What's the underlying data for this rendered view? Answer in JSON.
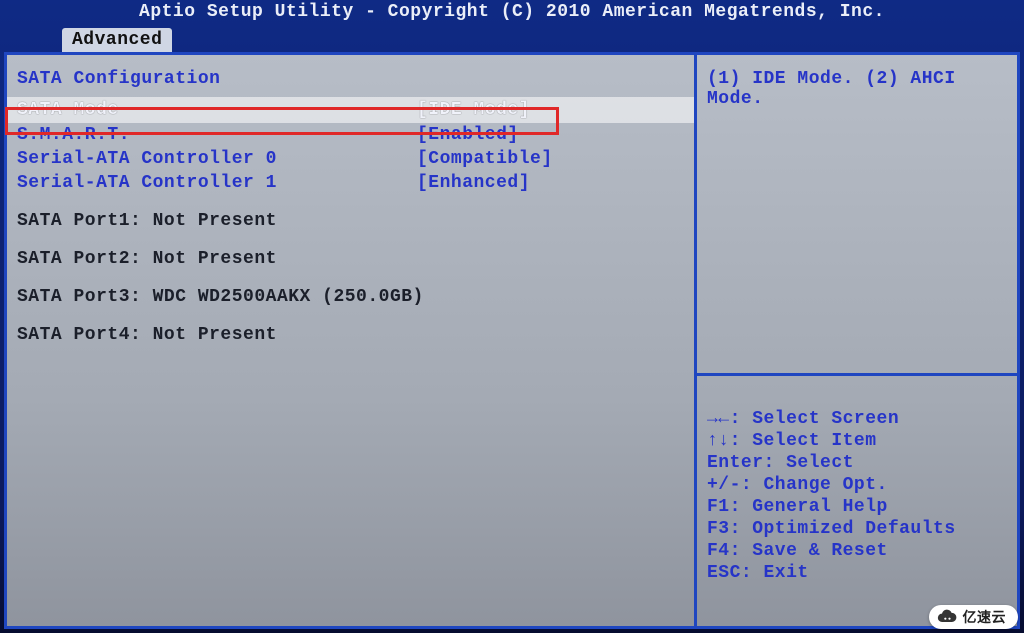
{
  "title": "Aptio Setup Utility - Copyright (C) 2010 American Megatrends, Inc.",
  "tab": {
    "advanced": "Advanced"
  },
  "section": {
    "title": "SATA Configuration"
  },
  "settings": [
    {
      "label": "SATA Mode",
      "value": "[IDE Mode]",
      "selected": true
    },
    {
      "label": "S.M.A.R.T.",
      "value": "[Enabled]",
      "selected": false
    },
    {
      "label": "Serial-ATA Controller 0",
      "value": "[Compatible]",
      "selected": false
    },
    {
      "label": "Serial-ATA Controller 1",
      "value": "[Enhanced]",
      "selected": false
    }
  ],
  "ports": [
    "SATA Port1: Not Present",
    "SATA Port2: Not Present",
    "SATA Port3: WDC WD2500AAKX (250.0GB)",
    "SATA Port4: Not Present"
  ],
  "help": {
    "text": "(1) IDE Mode. (2) AHCI Mode."
  },
  "keys": {
    "l1": "→←: Select Screen",
    "l2": "↑↓: Select Item",
    "l3": "Enter: Select",
    "l4": "+/-: Change Opt.",
    "l5": "F1: General Help",
    "l6": "F3: Optimized Defaults",
    "l7": "F4: Save & Reset",
    "l8": "ESC: Exit"
  },
  "watermark": "亿速云"
}
